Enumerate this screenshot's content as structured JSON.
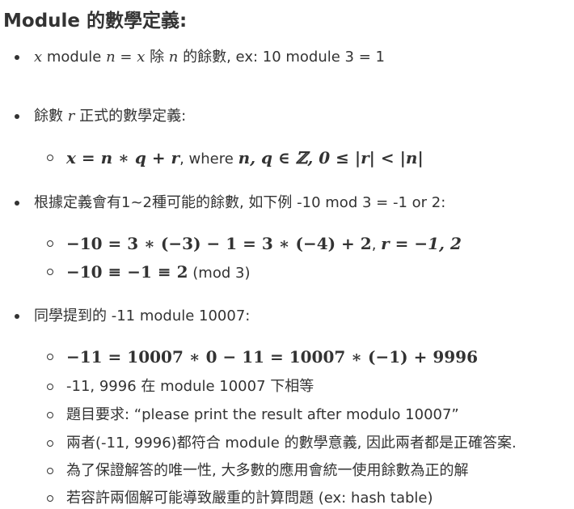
{
  "heading": "Module 的數學定義:",
  "items": [
    {
      "x": "x",
      "t1": " module ",
      "n": "n",
      "eq": " = ",
      "x2": "x",
      "t2": " 除 ",
      "n2": "n",
      "t3": " 的餘數, ex: 10 module 3 = 1"
    },
    {
      "t1": "餘數 ",
      "r": "r",
      "t2": " 正式的數學定義:"
    },
    {
      "math": "x = n ∗ q + r",
      "text": ", where ",
      "math2": "n, q ∈ ℤ, 0 ≤ |r| < |n|"
    },
    {
      "text": "根據定義會有1~2種可能的餘數, 如下例 -10 mod 3 = -1 or 2:"
    },
    {
      "math": "−10 = 3 ∗ (−3) − 1 = 3 ∗ (−4) + 2",
      "text": ", ",
      "math2": "r = −1, 2"
    },
    {
      "math": "−10 ≡ −1 ≡ 2",
      "text": " (mod 3)"
    },
    {
      "text": "同學提到的 -11 module 10007:"
    },
    {
      "math": "−11 = 10007 ∗ 0 − 11 = 10007 ∗ (−1) + 9996"
    },
    {
      "text": "-11, 9996 在 module 10007 下相等"
    },
    {
      "text": "題目要求: “please print the result after modulo 10007”"
    },
    {
      "text": "兩者(-11, 9996)都符合 module 的數學意義, 因此兩者都是正確答案."
    },
    {
      "text": "為了保證解答的唯一性, 大多數的應用會統一使用餘數為正的解"
    },
    {
      "text": "若容許兩個解可能導致嚴重的計算問題 (ex: hash table)"
    }
  ]
}
